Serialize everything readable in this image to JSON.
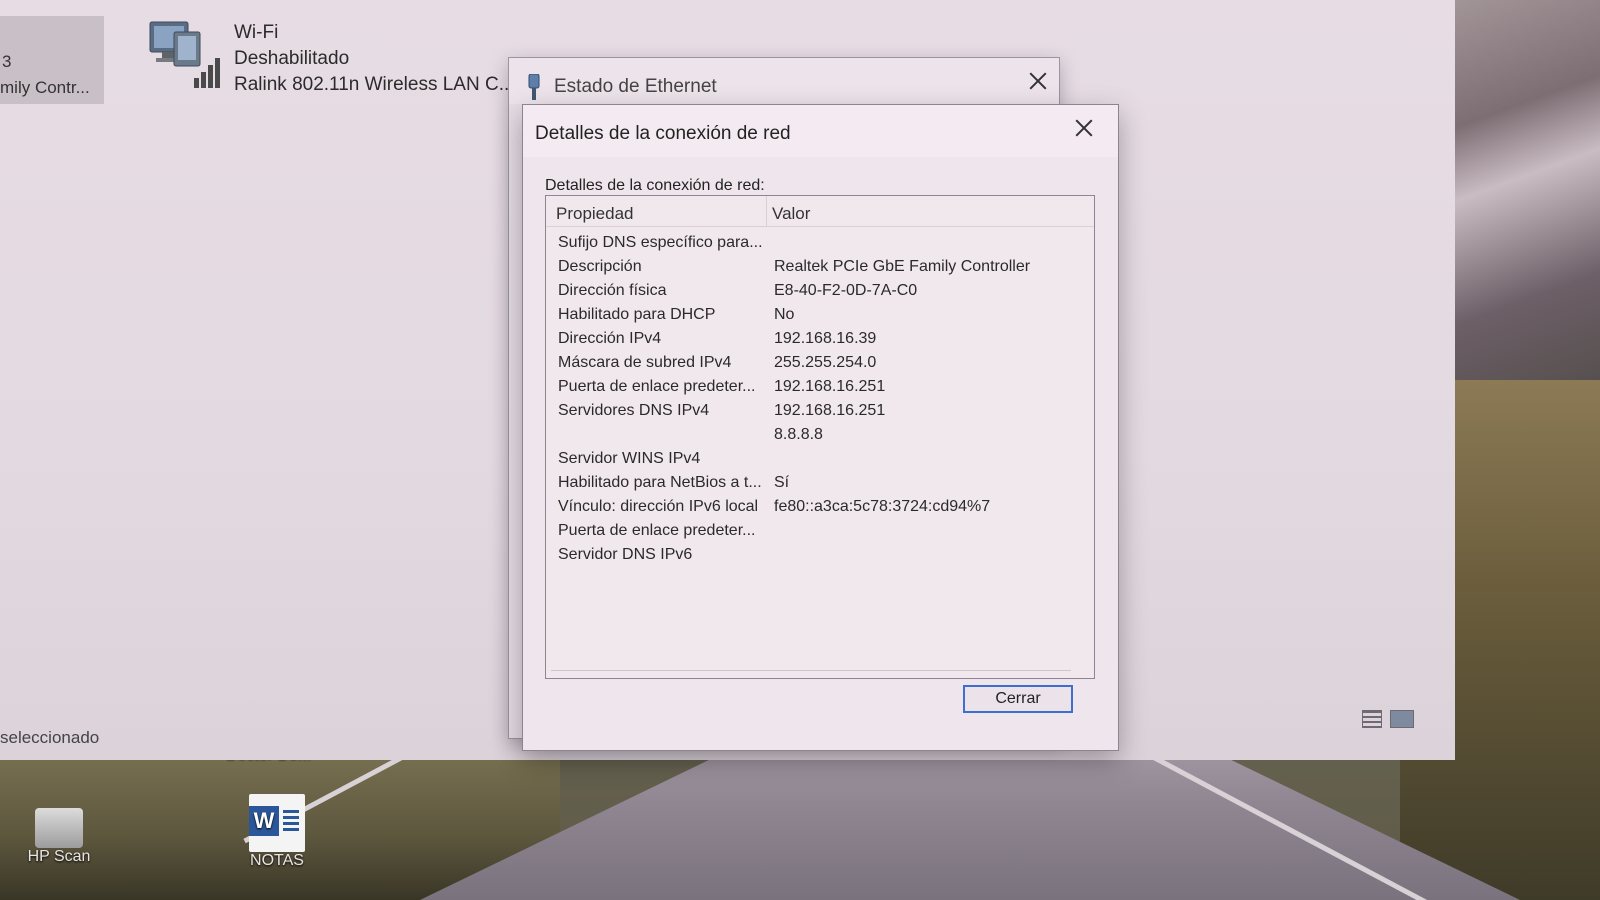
{
  "explorer": {
    "tile_number": "3",
    "tile_name": "mily Contr...",
    "wifi": {
      "name": "Wi-Fi",
      "status": "Deshabilitado",
      "adapter": "Ralink 802.11n Wireless LAN C..."
    },
    "status_bar": "seleccionado"
  },
  "ethernet_window": {
    "title": "Estado de Ethernet"
  },
  "details_dialog": {
    "title": "Detalles de la conexión de red",
    "section_label": "Detalles de la conexión de red:",
    "columns": {
      "property": "Propiedad",
      "value": "Valor"
    },
    "rows": [
      {
        "property": "Sufijo DNS específico para...",
        "value": ""
      },
      {
        "property": "Descripción",
        "value": "Realtek PCIe GbE Family Controller"
      },
      {
        "property": "Dirección física",
        "value": "E8-40-F2-0D-7A-C0"
      },
      {
        "property": "Habilitado para DHCP",
        "value": "No"
      },
      {
        "property": "Dirección IPv4",
        "value": "192.168.16.39"
      },
      {
        "property": "Máscara de subred IPv4",
        "value": "255.255.254.0"
      },
      {
        "property": "Puerta de enlace predeter...",
        "value": "192.168.16.251"
      },
      {
        "property": "Servidores DNS IPv4",
        "value": "192.168.16.251"
      },
      {
        "property": "",
        "value": "8.8.8.8"
      },
      {
        "property": "Servidor WINS IPv4",
        "value": ""
      },
      {
        "property": "Habilitado para NetBios a t...",
        "value": "Sí"
      },
      {
        "property": "Vínculo: dirección IPv6 local",
        "value": "fe80::a3ca:5c78:3724:cd94%7"
      },
      {
        "property": "Puerta de enlace predeter...",
        "value": ""
      },
      {
        "property": "Servidor DNS IPv6",
        "value": ""
      }
    ],
    "close_button": "Cerrar"
  },
  "desktop": {
    "doctor_label": "Doctor Do...",
    "icons": [
      {
        "label": "HP Scan",
        "icon": "scanner-icon"
      },
      {
        "label": "NOTAS",
        "icon": "word-document-icon"
      }
    ]
  }
}
